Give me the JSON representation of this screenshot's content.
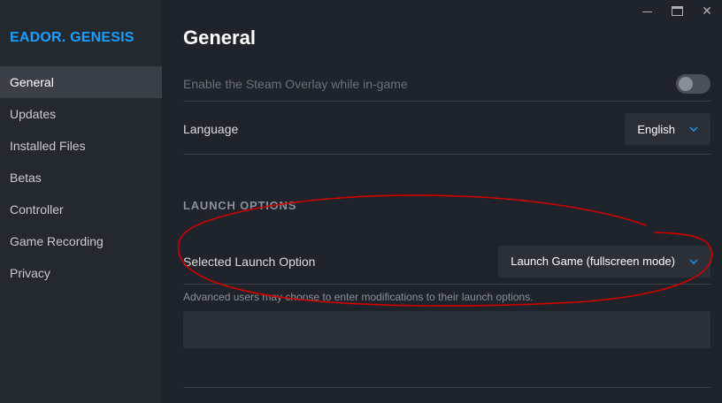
{
  "sidebar": {
    "game_title": "EADOR. GENESIS",
    "items": [
      {
        "label": "General",
        "active": true
      },
      {
        "label": "Updates"
      },
      {
        "label": "Installed Files"
      },
      {
        "label": "Betas"
      },
      {
        "label": "Controller"
      },
      {
        "label": "Game Recording"
      },
      {
        "label": "Privacy"
      }
    ]
  },
  "window_controls": {
    "close_glyph": "✕"
  },
  "main": {
    "title": "General",
    "overlay": {
      "label": "Enable the Steam Overlay while in-game",
      "enabled": false
    },
    "language": {
      "label": "Language",
      "value": "English"
    },
    "launch_options": {
      "section_title": "LAUNCH OPTIONS",
      "selected_label": "Selected Launch Option",
      "selected_value": "Launch Game (fullscreen mode)",
      "helper_text": "Advanced users may choose to enter modifications to their launch options.",
      "input_value": ""
    }
  },
  "colors": {
    "accent": "#1a9fff",
    "annotation": "#d40000",
    "background": "#1f232b",
    "sidebar": "#24282f"
  },
  "icons": [
    "minimize-icon",
    "maximize-icon",
    "close-icon",
    "chevron-down-icon"
  ]
}
